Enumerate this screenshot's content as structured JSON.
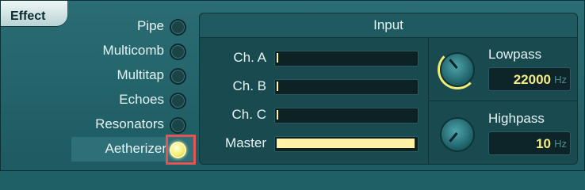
{
  "effect_tab": {
    "label": "Effect"
  },
  "effects": [
    {
      "label": "Pipe",
      "selected": false
    },
    {
      "label": "Multicomb",
      "selected": false
    },
    {
      "label": "Multitap",
      "selected": false
    },
    {
      "label": "Echoes",
      "selected": false
    },
    {
      "label": "Resonators",
      "selected": false
    },
    {
      "label": "Aetherizer",
      "selected": true
    }
  ],
  "input": {
    "title": "Input",
    "channels": [
      {
        "label": "Ch. A",
        "level": 0.0
      },
      {
        "label": "Ch. B",
        "level": 0.0
      },
      {
        "label": "Ch. C",
        "level": 0.0
      },
      {
        "label": "Master",
        "level": 1.0
      }
    ]
  },
  "lowpass": {
    "title": "Lowpass",
    "value": "22000",
    "unit": "Hz"
  },
  "highpass": {
    "title": "Highpass",
    "value": "10",
    "unit": "Hz"
  },
  "colors": {
    "accent_yellow": "#f4ec86",
    "highlight_red": "#e35555",
    "panel_teal": "#184a50"
  }
}
